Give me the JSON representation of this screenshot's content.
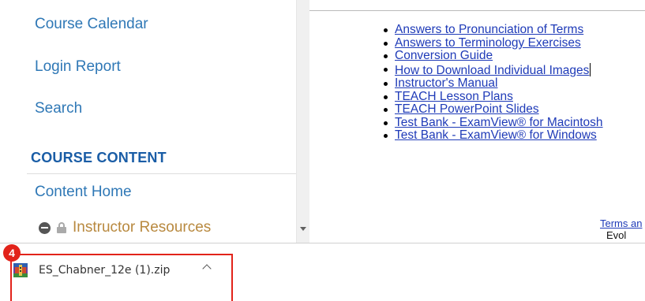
{
  "sidebar": {
    "nav": {
      "course_calendar": "Course Calendar",
      "login_report": "Login Report",
      "search": "Search"
    },
    "section_heading": "COURSE CONTENT",
    "content_home": "Content Home",
    "instructor_resources": "Instructor Resources"
  },
  "main": {
    "links": [
      "Answers to Pronunciation of Terms",
      "Answers to Terminology Exercises",
      "Conversion Guide",
      "How to Download Individual Images",
      "Instructor's Manual",
      "TEACH Lesson Plans",
      "TEACH PowerPoint Slides",
      "Test Bank - ExamView® for Macintosh",
      "Test Bank - ExamView® for Windows"
    ],
    "footer_terms": "Terms an",
    "footer_evolve": "Evol"
  },
  "download_bar": {
    "step_badge": "4",
    "file_name": "ES_Chabner_12e (1).zip"
  },
  "colors": {
    "nav_link": "#2f78b6",
    "section_heading": "#1a5da6",
    "resource_gold": "#b8893f",
    "content_link": "#1f3bb8",
    "highlight_red": "#e2231a"
  }
}
